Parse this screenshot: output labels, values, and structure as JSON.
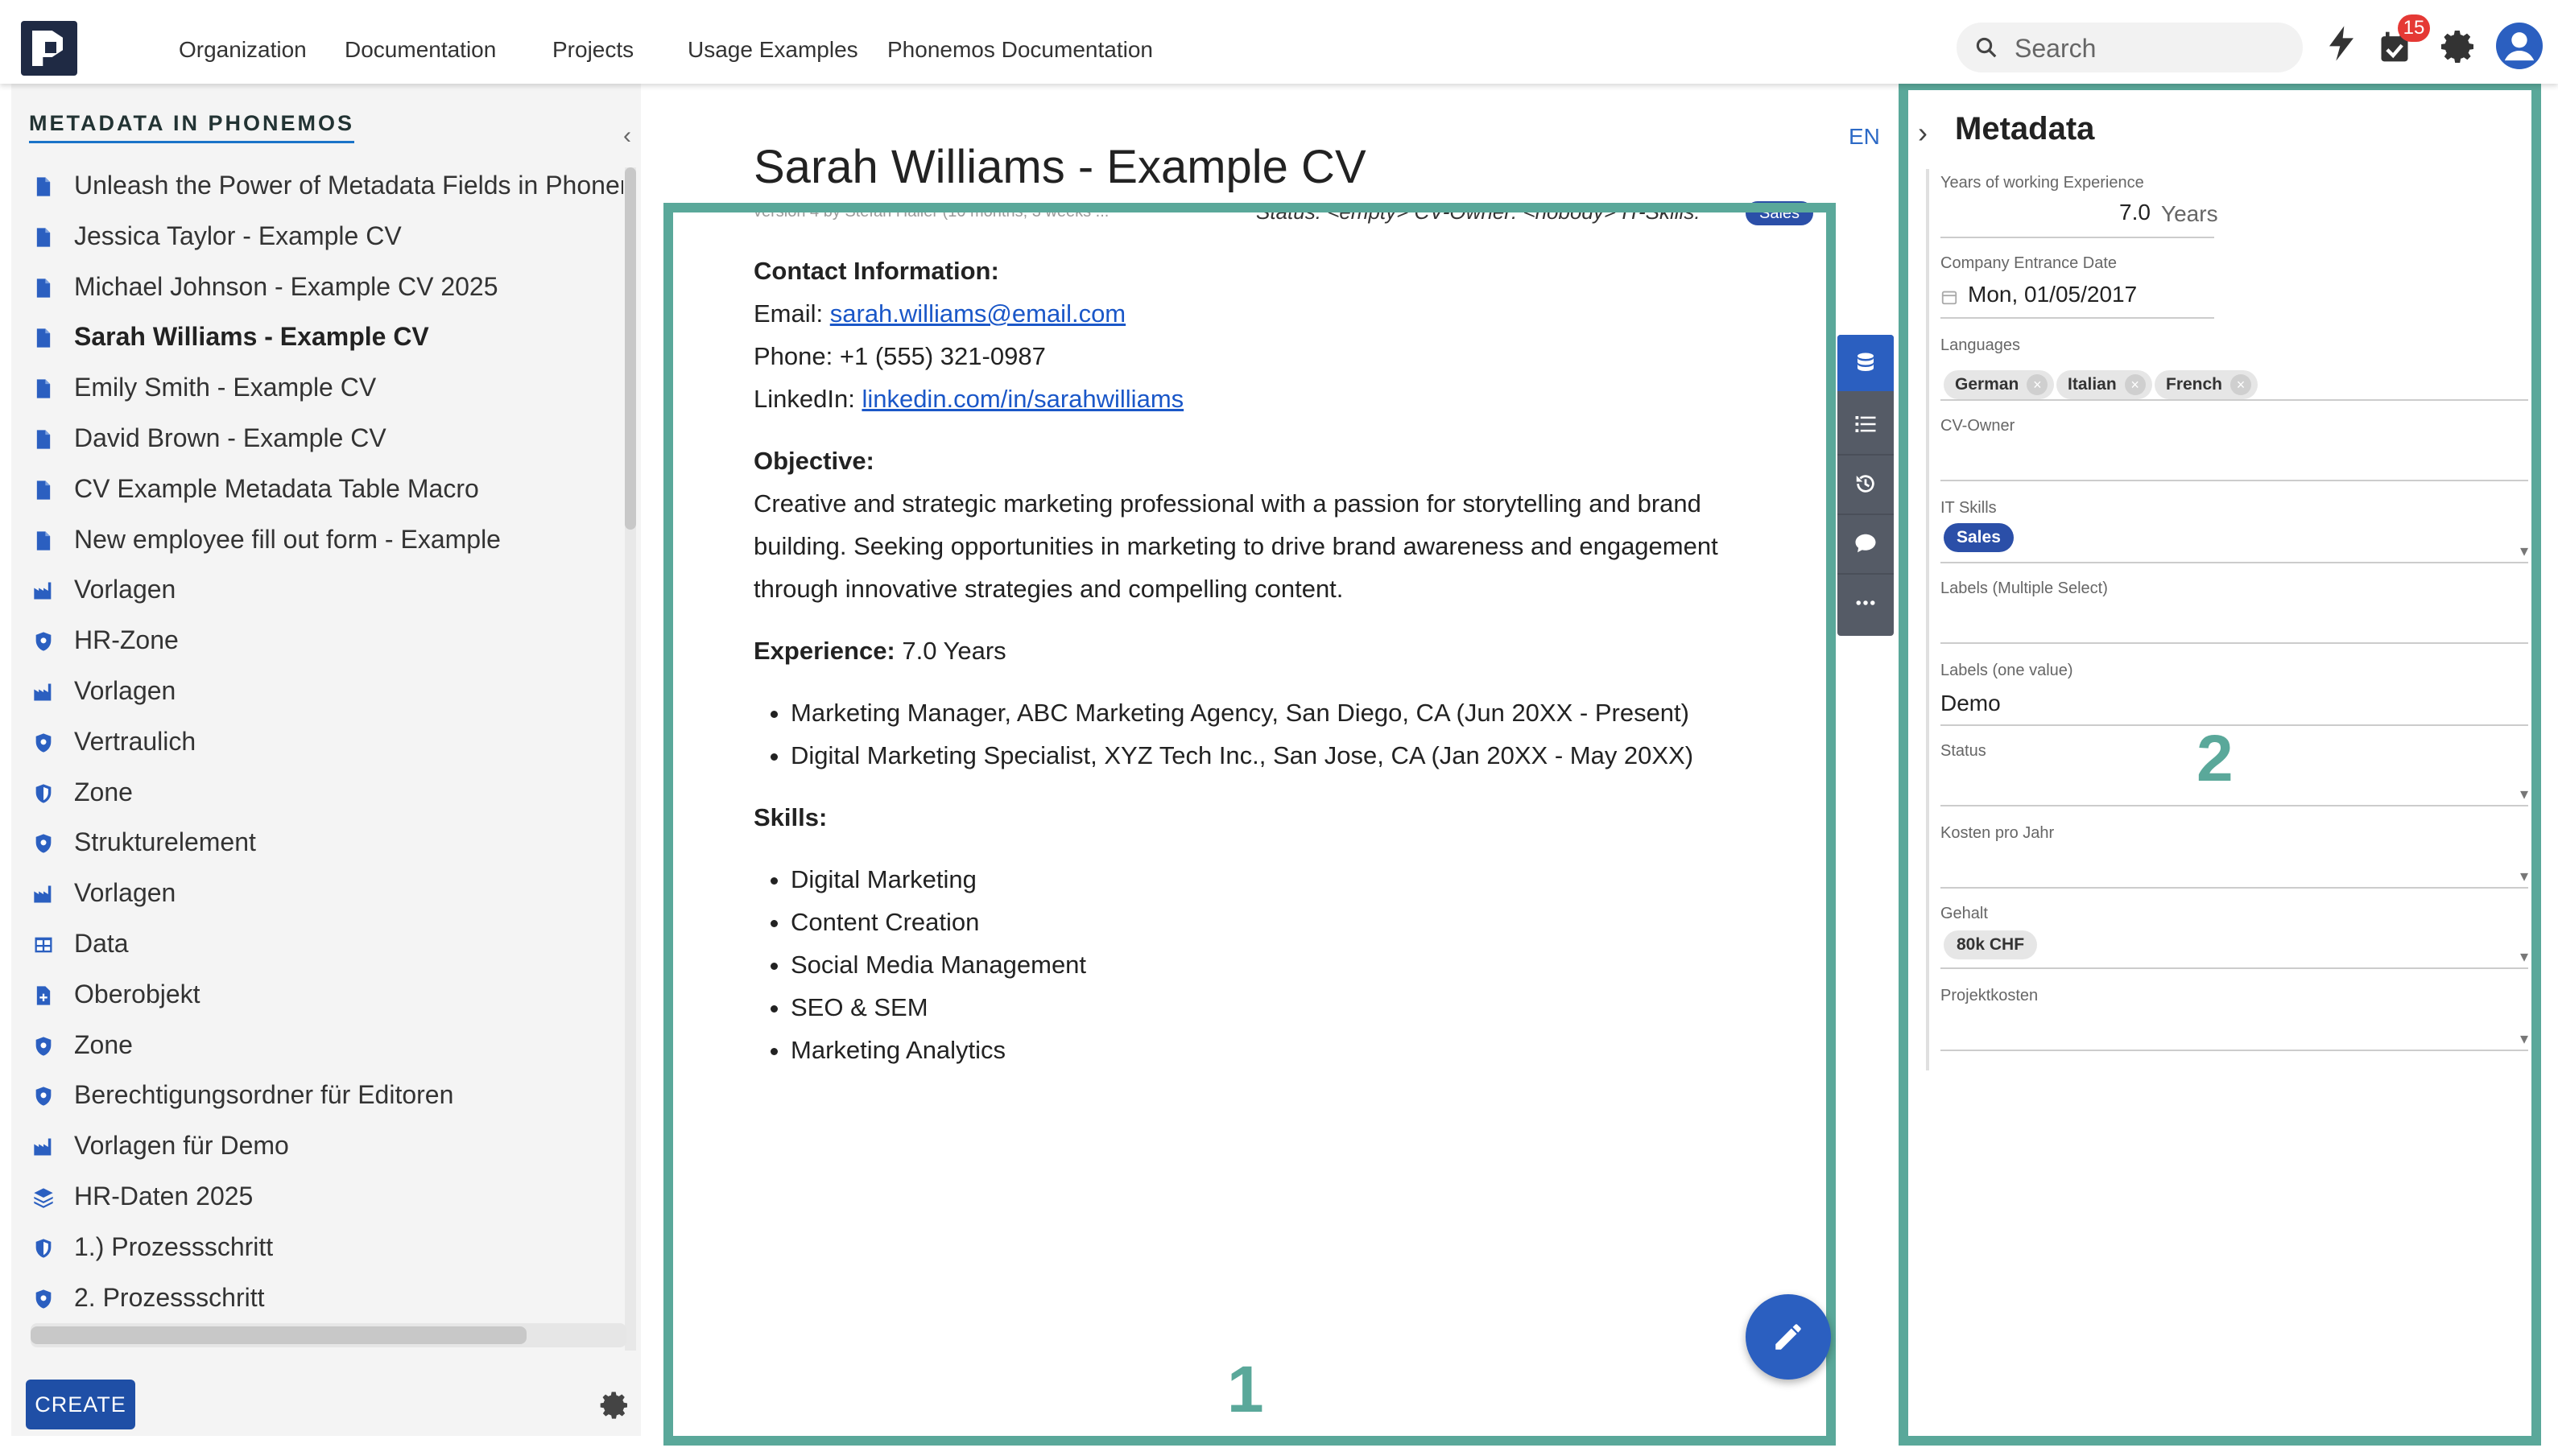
{
  "topbar": {
    "nav": [
      "Organization",
      "Documentation",
      "Projects",
      "Usage Examples",
      "Phonemos Documentation"
    ],
    "search_placeholder": "Search",
    "notification_count": "15"
  },
  "sidebar": {
    "title": "METADATA IN PHONEMOS",
    "items": [
      {
        "label": "Unleash the Power of Metadata Fields in Phonemos",
        "icon": "page-icon"
      },
      {
        "label": "Jessica Taylor - Example CV",
        "icon": "page-icon"
      },
      {
        "label": "Michael Johnson - Example CV 2025",
        "icon": "page-icon"
      },
      {
        "label": "Sarah Williams - Example CV",
        "icon": "page-icon",
        "active": true
      },
      {
        "label": "Emily Smith - Example CV",
        "icon": "page-icon"
      },
      {
        "label": "David Brown - Example CV",
        "icon": "page-icon"
      },
      {
        "label": "CV Example Metadata Table Macro",
        "icon": "page-icon"
      },
      {
        "label": "New employee fill out form - Example",
        "icon": "page-icon"
      },
      {
        "label": "Vorlagen",
        "icon": "factory-icon"
      },
      {
        "label": "HR-Zone",
        "icon": "shield-icon"
      },
      {
        "label": "Vorlagen",
        "icon": "factory-icon"
      },
      {
        "label": "Vertraulich",
        "icon": "shield-icon"
      },
      {
        "label": "Zone",
        "icon": "half-shield-icon"
      },
      {
        "label": "Strukturelement",
        "icon": "shield-icon"
      },
      {
        "label": "Vorlagen",
        "icon": "factory-icon"
      },
      {
        "label": "Data",
        "icon": "table-icon"
      },
      {
        "label": "Oberobjekt",
        "icon": "page-plus-icon"
      },
      {
        "label": "Zone",
        "icon": "shield-icon"
      },
      {
        "label": "Berechtigungsordner für Editoren",
        "icon": "shield-icon"
      },
      {
        "label": "Vorlagen für Demo",
        "icon": "factory-icon"
      },
      {
        "label": "HR-Daten 2025",
        "icon": "layers-icon"
      },
      {
        "label": "1.) Prozessschritt",
        "icon": "half-shield-icon"
      },
      {
        "label": "2. Prozessschritt",
        "icon": "shield-icon"
      }
    ],
    "create_label": "CREATE"
  },
  "main": {
    "title": "Sarah Williams - Example CV",
    "language": "EN",
    "version_line": "version 4 by Stefan Haller (10 months, 3 weeks ...",
    "status_line": "Status: <empty>  CV-Owner: <nobody>  IT-Skills:",
    "status_chip": "Sales",
    "contact_heading": "Contact Information:",
    "email_label": "Email: ",
    "email": "sarah.williams@email.com",
    "phone": "Phone: +1 (555) 321-0987",
    "linkedin_label": "LinkedIn: ",
    "linkedin": "linkedin.com/in/sarahwilliams",
    "objective_heading": "Objective:",
    "objective_text": "Creative and strategic marketing professional with a passion for storytelling and brand building. Seeking opportunities in marketing to drive brand awareness and engagement through innovative strategies and compelling content.",
    "experience_heading": "Experience:",
    "experience_value": " 7.0 Years",
    "experience_items": [
      "Marketing Manager, ABC Marketing Agency, San Diego, CA (Jun 20XX - Present)",
      "Digital Marketing Specialist, XYZ Tech Inc., San Jose, CA (Jan 20XX - May 20XX)"
    ],
    "skills_heading": "Skills:",
    "skills": [
      "Digital Marketing",
      "Content Creation",
      "Social Media Management",
      "SEO & SEM",
      "Marketing Analytics"
    ],
    "highlight_1": "1",
    "highlight_2": "2"
  },
  "metadata": {
    "title": "Metadata",
    "years_label": "Years of working Experience",
    "years_value": "7.0",
    "years_unit": "Years",
    "entrance_label": "Company Entrance Date",
    "entrance_value": "Mon, 01/05/2017",
    "languages_label": "Languages",
    "languages": [
      "German",
      "Italian",
      "French"
    ],
    "cv_owner_label": "CV-Owner",
    "it_skills_label": "IT Skills",
    "it_skills_chip": "Sales",
    "labels_multi_label": "Labels (Multiple Select)",
    "labels_one_label": "Labels (one value)",
    "labels_one_value": "Demo",
    "status_label": "Status",
    "kosten_label": "Kosten pro Jahr",
    "gehalt_label": "Gehalt",
    "gehalt_chip": "80k CHF",
    "projekt_label": "Projektkosten"
  },
  "colors": {
    "accent": "#2b5fc0",
    "highlight": "#5aa89a",
    "badge": "#e53935"
  }
}
